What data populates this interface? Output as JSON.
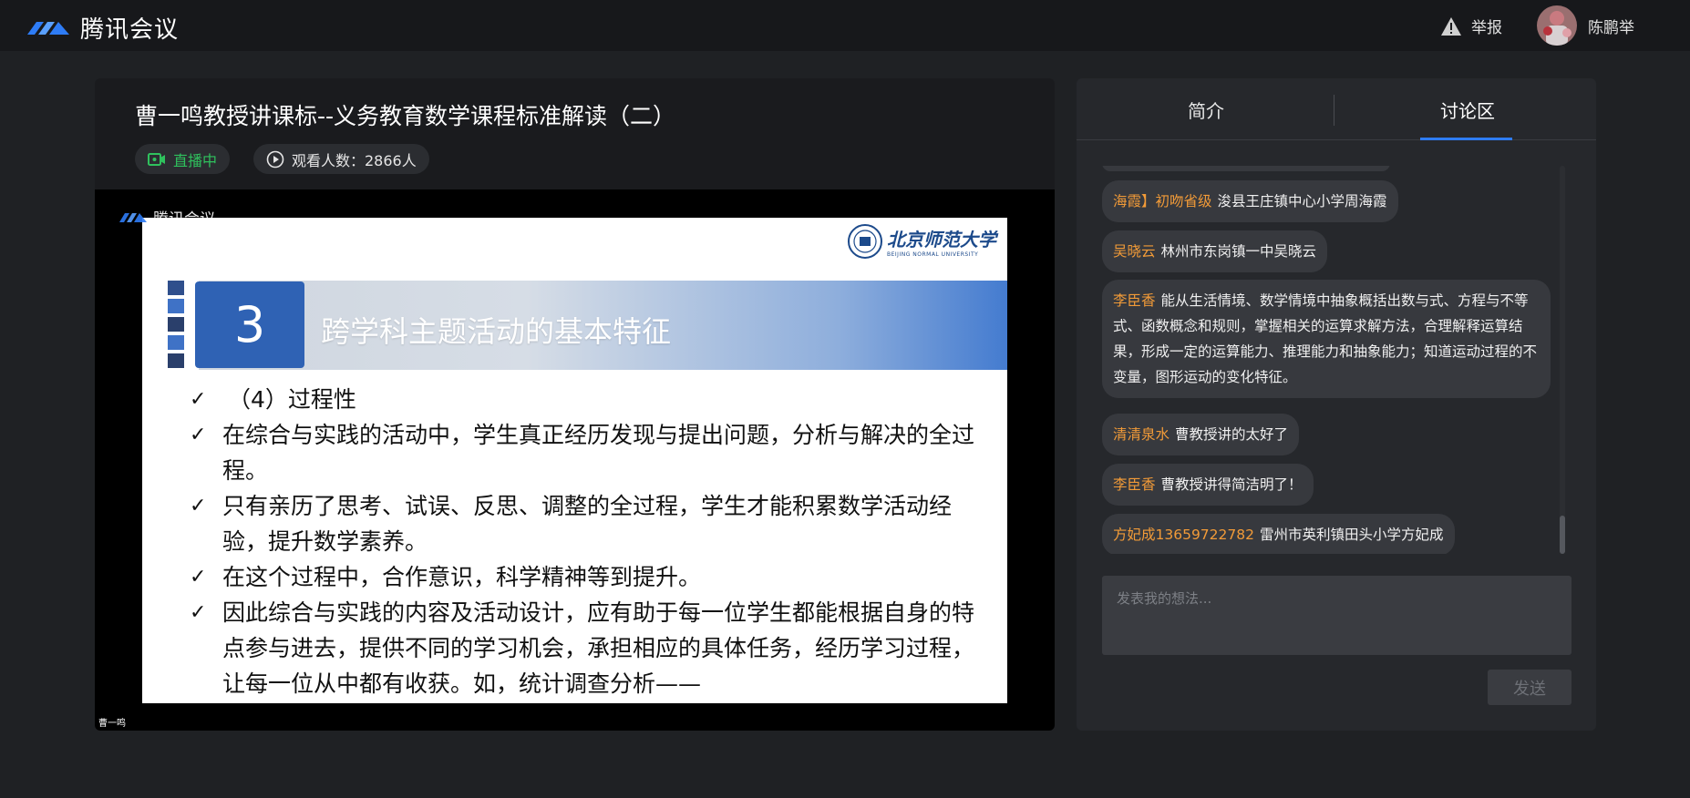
{
  "app": {
    "name": "腾讯会议"
  },
  "header": {
    "report_label": "举报",
    "user_name": "陈鹏举"
  },
  "video": {
    "title": "曹一鸣教授讲课标--义务教育数学课程标准解读（二）",
    "live_label": "直播中",
    "viewers_label": "观看人数：2866人",
    "overlay_brand": "腾讯会议",
    "speaker_tag": "曹一鸣"
  },
  "slide": {
    "university_cn": "北京师范大学",
    "university_en": "BEIJING NORMAL UNIVERSITY",
    "section_number": "3",
    "section_title": "跨学科主题活动的基本特征",
    "bullets": [
      "（4）过程性",
      "在综合与实践的活动中，学生真正经历发现与提出问题，分析与解决的全过程。",
      "只有亲历了思考、试误、反思、调整的全过程，学生才能积累数学活动经验，提升数学素养。",
      "在这个过程中，合作意识，科学精神等到提升。",
      "因此综合与实践的内容及活动设计，应有助于每一位学生都能根据自身的特点参与进去，提供不同的学习机会，承担相应的具体任务，经历学习过程，让每一位从中都有收获。如，统计调查分析——"
    ]
  },
  "side": {
    "tabs": [
      "简介",
      "讨论区"
    ],
    "active_tab": "讨论区",
    "messages": [
      {
        "name": "海霞】初吻省级",
        "text": "浚县王庄镇中心小学周海霞"
      },
      {
        "name": "吴晓云",
        "text": "林州市东岗镇一中吴晓云"
      },
      {
        "name": "李臣香",
        "text": "能从生活情境、数学情境中抽象概括出数与式、方程与不等式、函数概念和规则，掌握相关的运算求解方法，合理解释运算结果，形成一定的运算能力、推理能力和抽象能力；知道运动过程的不变量，图形运动的变化特征。"
      },
      {
        "name": "清清泉水",
        "text": "曹教授讲的太好了"
      },
      {
        "name": "李臣香",
        "text": "曹教授讲得简洁明了！"
      },
      {
        "name": "方妃成13659722782",
        "text": "雷州市英利镇田头小学方妃成"
      }
    ],
    "compose_placeholder": "发表我的想法...",
    "send_label": "发送"
  },
  "colors": {
    "accent": "#2e7cf6",
    "live": "#2fc15d",
    "username": "#f29b38",
    "slide_blue": "#2f62b4"
  }
}
